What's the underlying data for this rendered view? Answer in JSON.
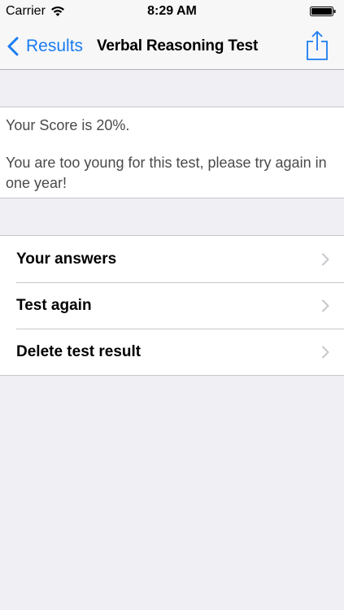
{
  "status_bar": {
    "carrier": "Carrier",
    "time": "8:29 AM"
  },
  "nav": {
    "back_label": "Results",
    "title": "Verbal Reasoning Test"
  },
  "score": {
    "score_text": "Your Score is 20%.",
    "message": "You are too young for this test, please try again in one year!"
  },
  "actions": [
    {
      "label": "Your answers"
    },
    {
      "label": "Test again"
    },
    {
      "label": "Delete test result"
    }
  ],
  "colors": {
    "accent": "#1a7cf2",
    "background": "#efeff4"
  }
}
